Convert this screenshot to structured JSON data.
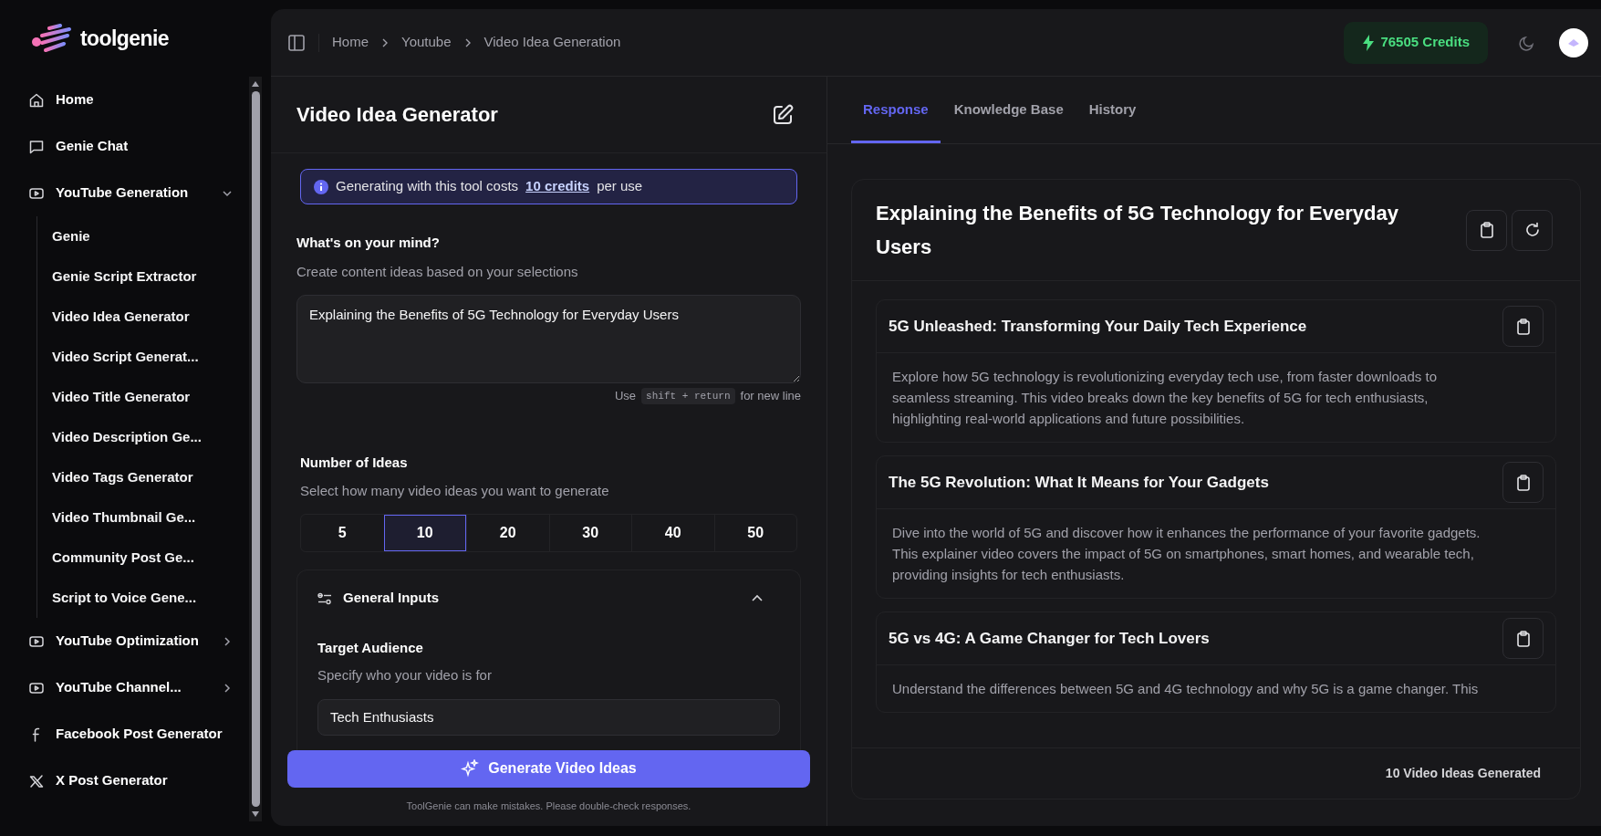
{
  "sidebar": {
    "logo": "toolgenie",
    "items": [
      {
        "kind": "link",
        "label": "Home"
      },
      {
        "kind": "link",
        "label": "Genie Chat"
      },
      {
        "kind": "group",
        "label": "YouTube Generation",
        "expanded": true,
        "children": [
          {
            "label": "Genie"
          },
          {
            "label": "Genie Script Extractor"
          },
          {
            "label": "Video Idea Generator"
          },
          {
            "label": "Video Script Generat..."
          },
          {
            "label": "Video Title Generator"
          },
          {
            "label": "Video Description Ge..."
          },
          {
            "label": "Video Tags Generator"
          },
          {
            "label": "Video Thumbnail Ge..."
          },
          {
            "label": "Community Post Ge..."
          },
          {
            "label": "Script to Voice Gene..."
          }
        ]
      },
      {
        "kind": "group",
        "label": "YouTube Optimization",
        "expanded": false
      },
      {
        "kind": "group",
        "label": "YouTube Channel...",
        "expanded": false
      },
      {
        "kind": "link",
        "label": "Facebook Post Generator"
      },
      {
        "kind": "link",
        "label": "X Post Generator"
      }
    ]
  },
  "breadcrumb": [
    "Home",
    "Youtube",
    "Video Idea Generation"
  ],
  "credits": "76505 Credits",
  "tool": {
    "title": "Video Idea Generator",
    "notice": {
      "before": "Generating with this tool costs",
      "link": "10 credits",
      "after": "per use"
    },
    "prompt": {
      "label": "What's on your mind?",
      "hint": "Create content ideas based on your selections",
      "value": "Explaining the Benefits of 5G Technology for Everyday Users",
      "shortcut": {
        "before": "Use",
        "keys": "shift + return",
        "after": "for new line"
      }
    },
    "ideas_count": {
      "label": "Number of Ideas",
      "hint": "Select how many video ideas you want to generate",
      "options": [
        {
          "label": "5",
          "selected": false
        },
        {
          "label": "10",
          "selected": true
        },
        {
          "label": "20",
          "selected": false
        },
        {
          "label": "30",
          "selected": false
        },
        {
          "label": "40",
          "selected": false
        },
        {
          "label": "50",
          "selected": false
        }
      ]
    },
    "general_inputs": {
      "title": "General Inputs",
      "expanded": true,
      "fields": [
        {
          "label": "Target Audience",
          "hint": "Specify who your video is for",
          "value": "Tech Enthusiasts"
        }
      ]
    },
    "generate_button": "Generate Video Ideas",
    "disclaimer": "ToolGenie can make mistakes. Please double-check responses."
  },
  "tabs": [
    {
      "label": "Response",
      "selected": true
    },
    {
      "label": "Knowledge Base",
      "selected": false
    },
    {
      "label": "History",
      "selected": false
    }
  ],
  "response": {
    "title": "Explaining the Benefits of 5G Technology for Everyday Users",
    "ideas": [
      {
        "title": "5G Unleashed: Transforming Your Daily Tech Experience",
        "description": "Explore how 5G technology is revolutionizing everyday tech use, from faster downloads to seamless streaming. This video breaks down the key benefits of 5G for tech enthusiasts, highlighting real-world applications and future possibilities."
      },
      {
        "title": "The 5G Revolution: What It Means for Your Gadgets",
        "description": "Dive into the world of 5G and discover how it enhances the performance of your favorite gadgets. This explainer video covers the impact of 5G on smartphones, smart homes, and wearable tech, providing insights for tech enthusiasts."
      },
      {
        "title": "5G vs 4G: A Game Changer for Tech Lovers",
        "description": "Understand the differences between 5G and 4G technology and why 5G is a game changer. This"
      }
    ],
    "footer": "10 Video Ideas Generated"
  }
}
